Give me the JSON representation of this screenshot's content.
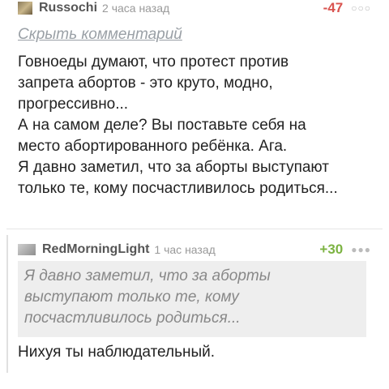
{
  "comment1": {
    "username": "Russochi",
    "time": "2 часа назад",
    "rating": "-47",
    "hide_link": "Скрыть комментарий",
    "body": "Говноеды думают, что протест против\nзапрета абортов - это круто, модно,\nпрогрессивно...\nА на самом деле? Вы поставьте себя на\nместо абортированного ребёнка. Ага.\nЯ давно заметил, что за аборты выступают\nтолько те, кому посчастливилось родиться..."
  },
  "comment2": {
    "username": "RedMorningLight",
    "time": "1 час назад",
    "rating": "+30",
    "quote": "Я давно заметил, что за аборты\nвыступают только те, кому\nпосчастливилось родиться...",
    "body": "Нихуя ты наблюдательный."
  },
  "colors": {
    "negative": "#d9534f",
    "positive": "#7cb342"
  }
}
